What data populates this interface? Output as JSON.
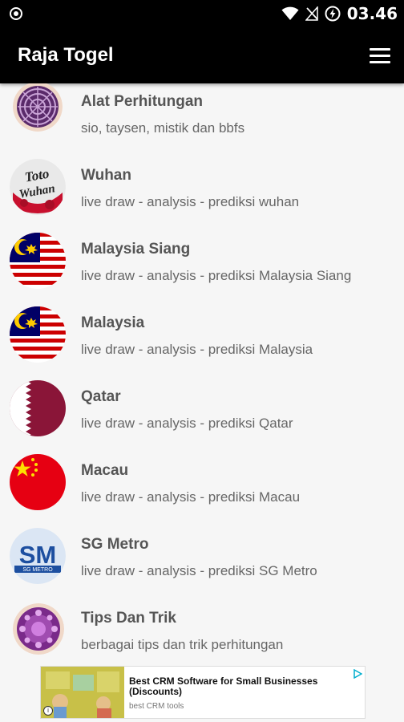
{
  "status_bar": {
    "time": "03.46"
  },
  "app_bar": {
    "title": "Raja Togel"
  },
  "menu": [
    {
      "title": "Alat Perhitungan",
      "subtitle": "sio, taysen, mistik dan bbfs",
      "icon": "purple-mandala-icon"
    },
    {
      "title": "Wuhan",
      "subtitle": "live draw - analysis - prediksi wuhan",
      "icon": "toto-wuhan-logo"
    },
    {
      "title": "Malaysia Siang",
      "subtitle": "live draw - analysis - prediksi Malaysia Siang",
      "icon": "malaysia-flag-icon"
    },
    {
      "title": "Malaysia",
      "subtitle": "live draw - analysis - prediksi Malaysia",
      "icon": "malaysia-flag-icon"
    },
    {
      "title": "Qatar",
      "subtitle": "live draw - analysis - prediksi Qatar",
      "icon": "qatar-flag-icon"
    },
    {
      "title": "Macau",
      "subtitle": "live draw - analysis - prediksi Macau",
      "icon": "china-flag-icon"
    },
    {
      "title": "SG Metro",
      "subtitle": "live draw - analysis - prediksi SG Metro",
      "icon": "sg-metro-logo"
    },
    {
      "title": "Tips Dan Trik",
      "subtitle": "berbagai tips dan trik perhitungan",
      "icon": "purple-flower-icon"
    }
  ],
  "ad": {
    "title": "Best CRM Software for Small Businesses (Discounts)",
    "source": "best CRM tools"
  },
  "colors": {
    "app_bar": "#000000",
    "background": "#f6f6f6",
    "title_text": "#555555",
    "subtitle_text": "#666666"
  }
}
